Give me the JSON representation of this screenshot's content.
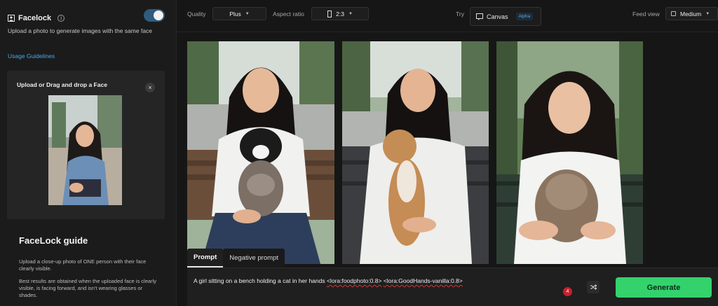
{
  "sidebar": {
    "title": "Facelock",
    "description": "Upload a photo to generate images with the same face",
    "usage_link": "Usage Guidelines",
    "toggle_on": true,
    "upload": {
      "title": "Upload or Drag and drop a Face",
      "close": "×"
    },
    "guide": {
      "title": "FaceLock guide",
      "p1": "Upload a close-up photo of ONE person with their face clearly visible.",
      "p2": "Best results are obtained when the uploaded face is clearly visible, is facing forward, and isn't wearing glasses or shades."
    }
  },
  "topbar": {
    "quality_label": "Quality",
    "quality_value": "Plus",
    "aspect_label": "Aspect ratio",
    "aspect_value": "2:3",
    "try_label": "Try",
    "canvas_label": "Canvas",
    "alpha_badge": "Alpha",
    "feed_label": "Feed view",
    "feed_value": "Medium"
  },
  "prompt": {
    "tabs": [
      "Prompt",
      "Negative prompt"
    ],
    "text_plain": "A girl sitting on a bench holding a cat in her hands ",
    "lora1": "<lora:foodphoto:0.8>",
    "lora2": "<lora:GoodHands-vanilla:0.8>",
    "badge_count": "4",
    "generate": "Generate"
  },
  "colors": {
    "accent": "#34d26d",
    "link": "#4aa8e8",
    "toggle": "#2f5c7d",
    "badge": "#c8202e"
  }
}
